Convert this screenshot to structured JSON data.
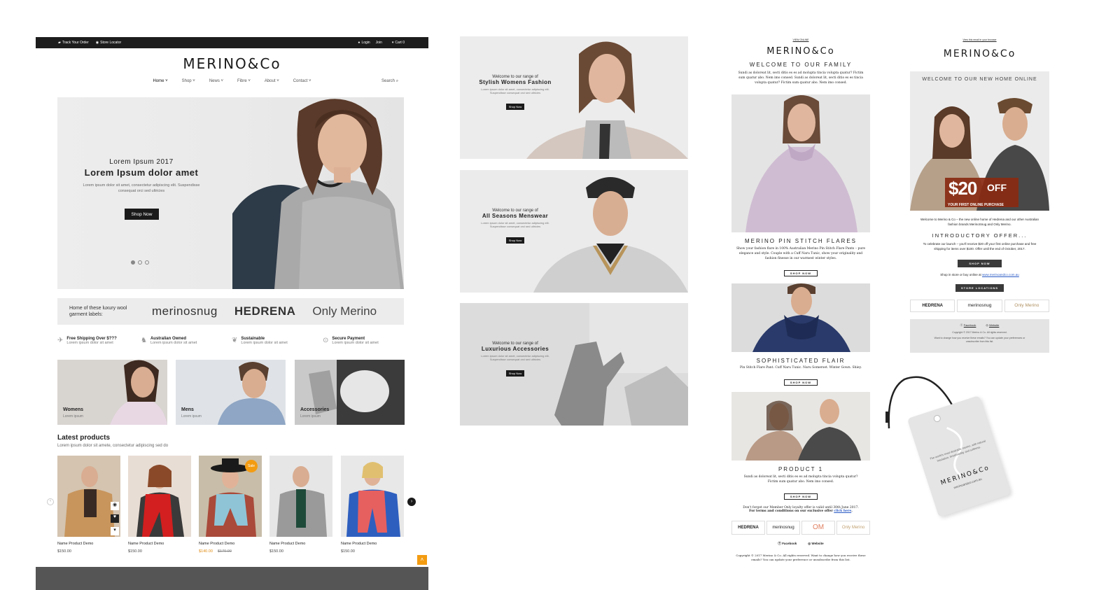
{
  "site": {
    "topbar": {
      "track": "Track Your Order",
      "store": "Store Locator",
      "login": "Login",
      "join": "Join",
      "cart": "Cart 0"
    },
    "logo": "MERINO&Co",
    "nav": [
      "Home",
      "Shop",
      "News",
      "Fibre",
      "About",
      "Contact"
    ],
    "search": "Search",
    "hero": {
      "subtitle": "Lorem Ipsum 2017",
      "title": "Lorem Ipsum dolor amet",
      "body": "Lorem ipsum dolor sit amet, consectetur adipiscing elit. Suspendisse consequat orci sed ultricies",
      "button": "Shop Now",
      "dots": 3,
      "active_dot": 0
    },
    "brands": {
      "intro": "Home of these luxury wool garment labels:",
      "items": [
        "merinosnug",
        "HEDRENA",
        "Only Merino"
      ]
    },
    "features": [
      {
        "title": "Free Shipping Over $???",
        "text": "Lorem ipsum dolor sit amet",
        "icon": "plane-icon"
      },
      {
        "title": "Australian Owned",
        "text": "Lorem ipsum dolor sit amet",
        "icon": "kangaroo-icon"
      },
      {
        "title": "Sustainable",
        "text": "Lorem ipsum dolor sit amet",
        "icon": "leaf-icon"
      },
      {
        "title": "Secure Payment",
        "text": "Lorem ipsum dolor sit amet",
        "icon": "lock-icon"
      }
    ],
    "categories": [
      {
        "title": "Womens",
        "text": "Lorem ipsum"
      },
      {
        "title": "Mens",
        "text": "Lorem ipsum"
      },
      {
        "title": "Accessories",
        "text": "Lorem ipsum"
      }
    ],
    "latest": {
      "title": "Latest products",
      "sub": "Lorem ipsum dolor sit amete, consectetur adipiscing sed do"
    },
    "products": [
      {
        "name": "Name Product Demo",
        "price": "$150.00",
        "sale": "",
        "old": ""
      },
      {
        "name": "Name Product Demo",
        "price": "$150.00",
        "sale": "",
        "old": ""
      },
      {
        "name": "Name Product Demo",
        "price": "$140.00",
        "sale": "Sale",
        "old": "$170.00"
      },
      {
        "name": "Name Product Demo",
        "price": "$150.00",
        "sale": "",
        "old": ""
      },
      {
        "name": "Name Product Demo",
        "price": "$150.00",
        "sale": "",
        "old": ""
      }
    ]
  },
  "banners": [
    {
      "small": "Welcome to our range of",
      "title": "Stylish Womens Fashion",
      "body": "Lorem ipsum dolor sit amet, consectetur adipiscing elit. Suspendisse consequat orci sed ultricies",
      "button": "Shop Now"
    },
    {
      "small": "Welcome to our range of",
      "title": "All Seasons Menswear",
      "body": "Lorem ipsum dolor sit amet, consectetur adipiscing elit. Suspendisse consequat orci sed ultricies",
      "button": "Shop Now"
    },
    {
      "small": "Welcome to our range of",
      "title": "Luxurious Accessories",
      "body": "Lorem ipsum dolor sit amet, consectetur adipiscing elit. Suspendisse consequat orci sed ultricies",
      "button": "Shop Now"
    }
  ],
  "email1": {
    "view": "VIEW ONLINE",
    "logo": "MERINO&Co",
    "heading": "WELCOME TO OUR FAMILY",
    "intro": "Sundi as doloreat lit, secti ditis es es ad molupta tincia volupta quatur? Fictim sum quatur abo. Nem imo consed. Sundi as doloreat lit, secti ditis es es tincia volupta quatur? Fictim sum quatur abo. Nem imo consed.",
    "s1_title": "MERINO PIN STITCH FLARES",
    "s1_text": "Show your fashion flare in 100% Australian Merino Pin Stitch Flare Pants – pure elegance and style. Couple with a Cuff Naru Tunic, show your originality and fashion finesse in our warmest winter styles.",
    "s2_title": "SOPHISTICATED FLAIR",
    "s2_text": "Pin Stitch Flare Pant. Cuff Naru Tunic. Naru Somerset. Winter Gown. Shiey.",
    "s3_title": "PRODUCT 1",
    "s3_text": "Sundi as doloreat lit, secti ditis es es ad molupta tincia volupta quatur? Fictim sum quatur abo. Nem imo consed.",
    "shop": "SHOP NOW",
    "loyalty": "Don't forget our Member Only loyalty offer is valid until 30th June 2017.",
    "terms": "For terms and conditions on our exclusive offer",
    "terms_link": "click here",
    "brands": [
      "HEDRENA",
      "merinosnug",
      "OM",
      "Only Merino"
    ],
    "facebook": "Facebook",
    "website": "Website",
    "copyright": "Copyright © 2017 Merino & Co. All rights reserved. Want to change how you receive these emails? You can update your preference or unsubscribe from this list."
  },
  "email2": {
    "view": "View this email in your browser",
    "logo": "MERINO&Co",
    "heading": "WELCOME TO OUR NEW HOME ONLINE",
    "offer_amount": "$20",
    "offer_word": "OFF",
    "offer_sub": "YOUR FIRST ONLINE PURCHASE",
    "welcome": "Welcome to Merino & Co – the new online home of Hedrena and our other Australian fashion brands MerinoSnug and Only Merino.",
    "intro_title": "INTRODUCTORY OFFER...",
    "intro_text": "To celebrate our launch – you'll receive $20 off your first online purchase and free shipping for items over $100. Offer until the end of October, 2017.",
    "shop": "SHOP NOW",
    "shop_line": "Shop in store or buy online at",
    "shop_link": "www.merinoandco.com.au",
    "stores": "STORE LOCATIONS",
    "brands": [
      "HEDRENA",
      "merinosnug",
      "Only Merino"
    ],
    "facebook": "Facebook",
    "website": "Website",
    "copyright": "Copyright © 2017 Merino & Co. All rights reserved.",
    "prefs": "Want to change how you receive these emails? You can update your preferences or unsubscribe from this list."
  },
  "tag": {
    "text": "The world's most desirable merino, with natural insulation, breathability and softness.",
    "logo": "MERINO&Co",
    "url": "merinoandco.com.au"
  },
  "colors": {
    "dark": "#1d1d1d",
    "accent": "#f39c12",
    "gray_bg": "#ececec"
  }
}
